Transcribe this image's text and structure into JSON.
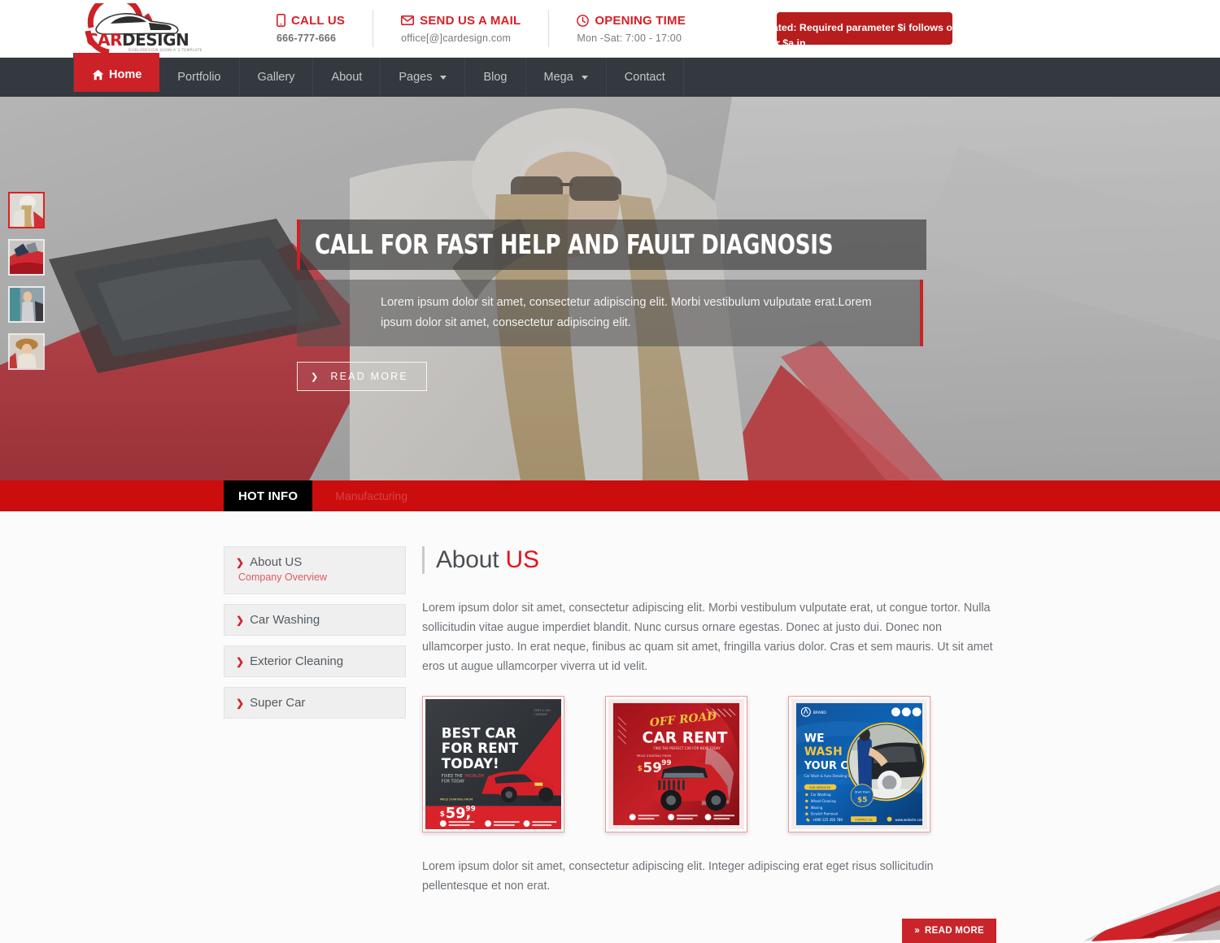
{
  "brand": {
    "logo_primary": "CAR",
    "logo_secondary": "DESIGN",
    "logo_tagline": "DUBLODESIGN JOOMLA 3 TEMPLATE"
  },
  "colors": {
    "accent_red": "#cc2127",
    "ticker_red": "#cc0d0d",
    "nav_dark": "#33393f",
    "error_red": "#b81d1d",
    "heading_gray": "#4a4f54"
  },
  "topbar": {
    "contacts": [
      {
        "icon": "phone-icon",
        "title": "CALL US",
        "value": "666-777-666",
        "bold": true
      },
      {
        "icon": "mail-icon",
        "title": "SEND US A MAIL",
        "value": "office[@]cardesign.com",
        "bold": false
      },
      {
        "icon": "clock-icon",
        "title": "OPENING TIME",
        "value": "Mon -Sat: 7:00 - 17:00",
        "bold": false
      }
    ],
    "error": {
      "line1": "cated: Required parameter $i follows opt",
      "line2": "ter $a in"
    }
  },
  "nav": {
    "items": [
      {
        "label": "Home",
        "icon": "home-icon",
        "active": true,
        "caret": false
      },
      {
        "label": "Portfolio",
        "icon": "",
        "active": false,
        "caret": false
      },
      {
        "label": "Gallery",
        "icon": "",
        "active": false,
        "caret": false
      },
      {
        "label": "About",
        "icon": "",
        "active": false,
        "caret": false
      },
      {
        "label": "Pages",
        "icon": "",
        "active": false,
        "caret": true
      },
      {
        "label": "Blog",
        "icon": "",
        "active": false,
        "caret": false
      },
      {
        "label": "Mega",
        "icon": "",
        "active": false,
        "caret": true
      },
      {
        "label": "Contact",
        "icon": "",
        "active": false,
        "caret": false
      }
    ]
  },
  "hero": {
    "title": "CALL FOR FAST HELP AND FAULT DIAGNOSIS",
    "description": "Lorem ipsum dolor sit amet, consectetur adipiscing elit. Morbi vestibulum vulputate erat.Lorem ipsum dolor sit amet, consectetur adipiscing elit.",
    "button_label": "READ MORE",
    "thumbnails": [
      {
        "name": "slide-thumb-1",
        "active": true
      },
      {
        "name": "slide-thumb-2",
        "active": false
      },
      {
        "name": "slide-thumb-3",
        "active": false
      },
      {
        "name": "slide-thumb-4",
        "active": false
      }
    ]
  },
  "ticker": {
    "label": "HOT INFO",
    "text": "Manufacturing"
  },
  "sidebar": {
    "items": [
      {
        "label": "About US",
        "sub": "Company Overview",
        "active": true
      },
      {
        "label": "Car Washing",
        "sub": "",
        "active": false
      },
      {
        "label": "Exterior Cleaning",
        "sub": "",
        "active": false
      },
      {
        "label": "Super Car",
        "sub": "",
        "active": false
      }
    ]
  },
  "about": {
    "title_part1": "About",
    "title_part2": "US",
    "paragraph1": "Lorem ipsum dolor sit amet, consectetur adipiscing elit. Morbi vestibulum vulputate erat, ut congue tortor. Nulla sollicitudin vitae augue imperdiet blandit. Nunc cursus ornare egestas. Donec at justo dui. Donec non ullamcorper justo. In erat neque, finibus ac quam sit amet, fringilla varius dolor. Cras et sem mauris. Ut sit amet eros ut augue ullamcorper viverra ut id velit.",
    "paragraph2": "Lorem ipsum dolor sit amet, consectetur adipiscing elit. Integer adipiscing erat eget risus sollicitudin pellentesque et non erat.",
    "read_more_label": "READ MORE",
    "cards": [
      {
        "name": "card-best-car-for-rent",
        "headline": "BEST CAR FOR RENT TODAY!",
        "sub": "FIXED THE PROBLEM FOR TODAY",
        "price": "59,",
        "price_cents": "99",
        "currency": "$",
        "theme": "dark"
      },
      {
        "name": "card-off-road-car-rent",
        "headline_script": "OFF ROAD",
        "headline": "CAR RENT",
        "sub": "FIND THE PERFECT CAR FOR NEXT TODAY",
        "price_label": "PRICE STARTING FROM",
        "price": "59,",
        "price_cents": "99",
        "currency": "$",
        "theme": "red"
      },
      {
        "name": "card-we-wash-your-car",
        "headline_line1": "WE",
        "headline_line2": "WASH",
        "headline_line3": "YOUR CAR",
        "sub": "Car Wash & Auto Detailing Specialist",
        "price_label": "Start From",
        "price": "5",
        "currency": "$",
        "phone": "+090 125 456 789",
        "website": "www.website.com",
        "features": [
          "Car Washing",
          "Wheel Cleaning",
          "Waxing",
          "Scratch Removal"
        ],
        "theme": "blue"
      }
    ]
  }
}
